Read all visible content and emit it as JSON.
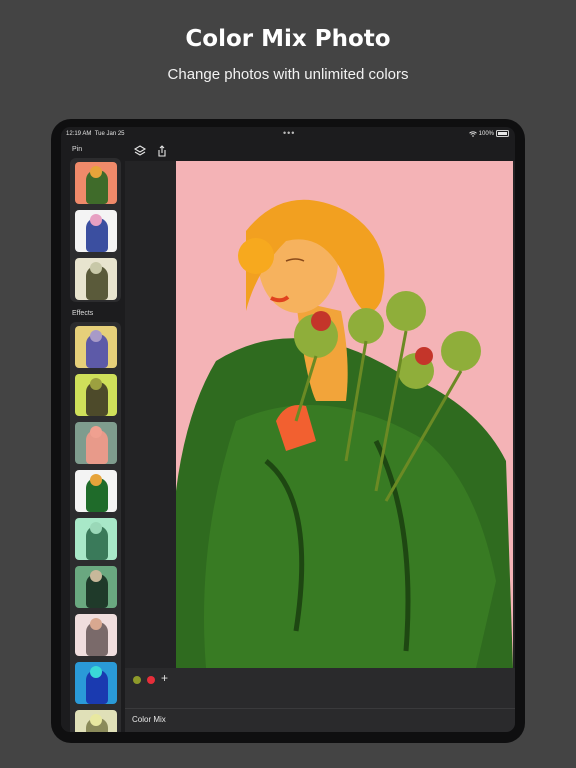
{
  "promo": {
    "title": "Color Mix Photo",
    "subtitle": "Change photos with unlimited colors"
  },
  "status_bar": {
    "time": "12:19 AM",
    "date": "Tue Jan 25",
    "battery": "100%",
    "wifi_icon": "wifi-icon",
    "battery_icon": "battery-icon"
  },
  "sidebar": {
    "pin_label": "Pin",
    "effects_label": "Effects",
    "pin_thumbnails": [
      {
        "bg": "#f08a6a",
        "figure": "#3f6b2a",
        "head": "#e6a33a"
      },
      {
        "bg": "#f4f4f4",
        "figure": "#3b4fa0",
        "head": "#e7a0c2"
      },
      {
        "bg": "#e8e4cf",
        "figure": "#5a5a3a",
        "head": "#c8c8a8"
      }
    ],
    "effect_thumbnails": [
      {
        "bg": "#e6d07a",
        "figure": "#5d5aa8",
        "head": "#a89ac8"
      },
      {
        "bg": "#cfe05a",
        "figure": "#4d4a2a",
        "head": "#9ca040"
      },
      {
        "bg": "#7f9c8e",
        "figure": "#e89a8a",
        "head": "#f0a090"
      },
      {
        "bg": "#f4f4f4",
        "figure": "#1f6b2a",
        "head": "#e6a33a"
      },
      {
        "bg": "#a8e8c8",
        "figure": "#3a7a5a",
        "head": "#9ad8b8"
      },
      {
        "bg": "#6aa880",
        "figure": "#1f3a2a",
        "head": "#c8b89a"
      },
      {
        "bg": "#f0dede",
        "figure": "#7a6a6a",
        "head": "#d8a890"
      },
      {
        "bg": "#2a9ad8",
        "figure": "#1a3ab0",
        "head": "#3ad8d8"
      },
      {
        "bg": "#e0e0b8",
        "figure": "#8a8a5a",
        "head": "#e8e8a0"
      }
    ]
  },
  "toolbar": {
    "layers_icon": "layers-icon",
    "share_icon": "share-icon",
    "more_icon": "more-dots-icon"
  },
  "colors": {
    "swatches": [
      "#8e9a2a",
      "#e62e3a"
    ],
    "add_icon": "+",
    "photo_bg": "#f4b3b6"
  },
  "mode": {
    "label": "Color Mix"
  }
}
